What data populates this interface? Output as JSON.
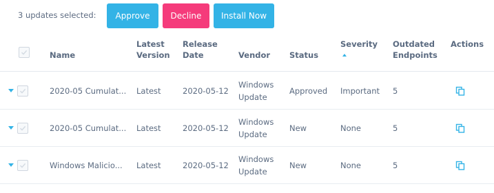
{
  "toolbar": {
    "selected_text": "3 updates selected:",
    "approve_label": "Approve",
    "decline_label": "Decline",
    "install_label": "Install Now"
  },
  "table": {
    "headers": {
      "name": "Name",
      "latest_version_1": "Latest",
      "latest_version_2": "Version",
      "release_date_1": "Release",
      "release_date_2": "Date",
      "vendor": "Vendor",
      "status": "Status",
      "severity": "Severity",
      "outdated_1": "Outdated",
      "outdated_2": "Endpoints",
      "actions": "Actions"
    },
    "sort": {
      "column": "Severity",
      "direction": "ascending"
    },
    "rows": [
      {
        "name": "2020-05 Cumulat...",
        "latest_version": "Latest",
        "release_date": "2020-05-12",
        "vendor_1": "Windows",
        "vendor_2": "Update",
        "status": "Approved",
        "severity": "Important",
        "outdated": "5"
      },
      {
        "name": "2020-05 Cumulat...",
        "latest_version": "Latest",
        "release_date": "2020-05-12",
        "vendor_1": "Windows",
        "vendor_2": "Update",
        "status": "New",
        "severity": "None",
        "outdated": "5"
      },
      {
        "name": "Windows Malicio...",
        "latest_version": "Latest",
        "release_date": "2020-05-12",
        "vendor_1": "Windows",
        "vendor_2": "Update",
        "status": "New",
        "severity": "None",
        "outdated": "5"
      }
    ]
  },
  "colors": {
    "primary_button": "#33b3e6",
    "decline_button": "#f53b7b",
    "text": "#5a6a80"
  },
  "icons": {
    "expand": "chevron-down-icon",
    "checkbox": "check-icon",
    "action": "copy-icon"
  }
}
